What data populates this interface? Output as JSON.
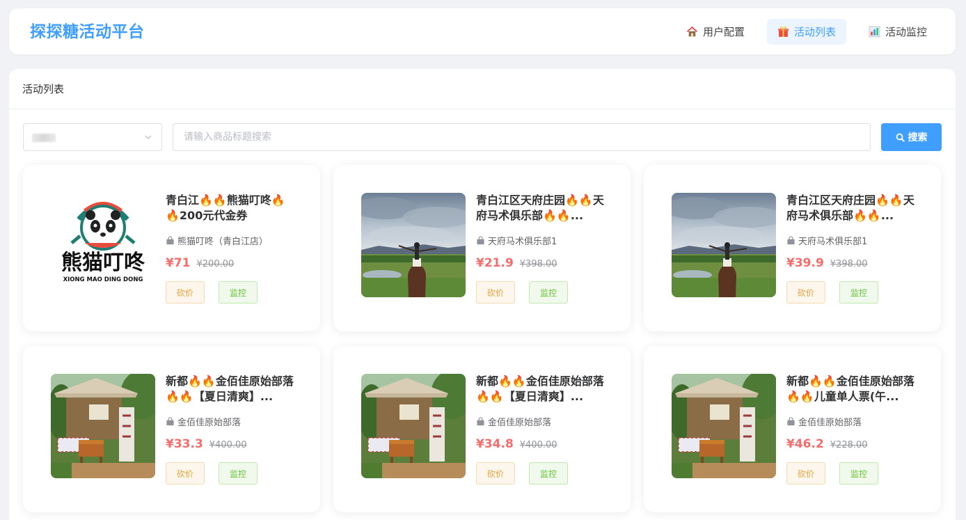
{
  "app": {
    "logo": "探探糖活动平台",
    "nav": [
      {
        "label": "用户配置",
        "icon": "house-icon",
        "active": false
      },
      {
        "label": "活动列表",
        "icon": "gift-icon",
        "active": true
      },
      {
        "label": "活动监控",
        "icon": "bar-chart-icon",
        "active": false
      }
    ]
  },
  "panel": {
    "title": "活动列表"
  },
  "filters": {
    "search_placeholder": "请输入商品标题搜索",
    "search_button": "搜索"
  },
  "products": [
    {
      "title": "青白江🔥🔥熊猫叮咚🔥🔥200元代金券",
      "shop": "熊猫叮咚（青白江店）",
      "price": "¥71",
      "original_price": "¥200.00",
      "image": "xiong-mao-ding-dong-logo",
      "logo_text": "熊猫叮咚",
      "logo_subtext": "XIONG MAO DING DONG",
      "bargain_label": "砍价",
      "monitor_label": "监控"
    },
    {
      "title": "青白江区天府庄园🔥🔥天府马术俱乐部🔥🔥...",
      "shop": "天府马术俱乐部1",
      "price": "¥21.9",
      "original_price": "¥398.00",
      "image": "horse-riding-photo",
      "bargain_label": "砍价",
      "monitor_label": "监控"
    },
    {
      "title": "青白江区天府庄园🔥🔥天府马术俱乐部🔥🔥...",
      "shop": "天府马术俱乐部1",
      "price": "¥39.9",
      "original_price": "¥398.00",
      "image": "horse-riding-photo",
      "bargain_label": "砍价",
      "monitor_label": "监控"
    },
    {
      "title": "新都🔥🔥金佰佳原始部落🔥🔥【夏日清爽】...",
      "shop": "金佰佳原始部落",
      "price": "¥33.3",
      "original_price": "¥400.00",
      "image": "garden-pavilion-photo",
      "bargain_label": "砍价",
      "monitor_label": "监控"
    },
    {
      "title": "新都🔥🔥金佰佳原始部落🔥🔥【夏日清爽】...",
      "shop": "金佰佳原始部落",
      "price": "¥34.8",
      "original_price": "¥400.00",
      "image": "garden-pavilion-photo",
      "bargain_label": "砍价",
      "monitor_label": "监控"
    },
    {
      "title": "新都🔥🔥金佰佳原始部落🔥🔥儿童单人票(午...",
      "shop": "金佰佳原始部落",
      "price": "¥46.2",
      "original_price": "¥228.00",
      "image": "garden-pavilion-photo",
      "bargain_label": "砍价",
      "monitor_label": "监控"
    }
  ],
  "colors": {
    "primary": "#409eff",
    "price": "#f56c6c",
    "bargain": "#e6a23c",
    "monitor": "#67c23a"
  }
}
